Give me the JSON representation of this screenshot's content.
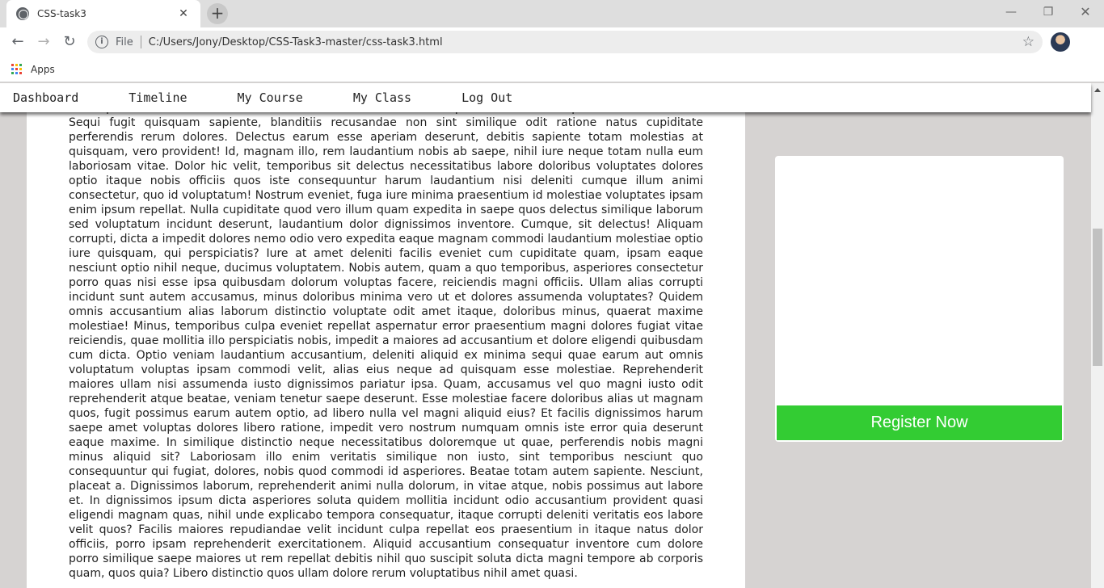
{
  "browser": {
    "tab_title": "CSS-task3",
    "tab_close": "✕",
    "new_tab": "+",
    "window_controls": {
      "minimize": "—",
      "maximize": "❐",
      "close": "✕"
    },
    "scheme_label": "File",
    "url": "C:/Users/Jony/Desktop/CSS-Task3-master/css-task3.html",
    "bookmarks": {
      "apps_label": "Apps",
      "apps_colors": [
        "#ea4335",
        "#fbbc05",
        "#34a853",
        "#4285f4",
        "#ea4335",
        "#fbbc05",
        "#34a853",
        "#4285f4",
        "#ea4335"
      ]
    }
  },
  "nav": {
    "items": [
      "Dashboard",
      "Timeline",
      "My Course",
      "My Class",
      "Log Out"
    ]
  },
  "article": {
    "body": "consequuntur cos omnis alias rerum veritatis molestias vero voluptas earum soluta quam dolores laborum. Sequi fugit quisquam sapiente, blanditiis recusandae non sint similique odit ratione natus cupiditate perferendis rerum dolores. Delectus earum esse aperiam deserunt, debitis sapiente totam molestias at quisquam, vero provident! Id, magnam illo, rem laudantium nobis ab saepe, nihil iure neque totam nulla eum laboriosam vitae. Dolor hic velit, temporibus sit delectus necessitatibus labore doloribus voluptates dolores optio itaque nobis officiis quos iste consequuntur harum laudantium nisi deleniti cumque illum animi consectetur, quo id voluptatum! Nostrum eveniet, fuga iure minima praesentium id molestiae voluptates ipsam enim ipsum repellat. Nulla cupiditate quod vero illum quam expedita in saepe quos delectus similique laborum sed voluptatum incidunt deserunt, laudantium dolor dignissimos inventore. Cumque, sit delectus! Aliquam corrupti, dicta a impedit dolores nemo odio vero expedita eaque magnam commodi laudantium molestiae optio iure quisquam, qui perspiciatis? Iure at amet deleniti facilis eveniet cum cupiditate quam, ipsam eaque nesciunt optio nihil neque, ducimus voluptatem. Nobis autem, quam a quo temporibus, asperiores consectetur porro quas nisi esse ipsa quibusdam dolorum voluptas facere, reiciendis magni officiis. Ullam alias corrupti incidunt sunt autem accusamus, minus doloribus minima vero ut et dolores assumenda voluptates? Quidem omnis accusantium alias laborum distinctio voluptate odit amet itaque, doloribus minus, quaerat maxime molestiae! Minus, temporibus culpa eveniet repellat aspernatur error praesentium magni dolores fugiat vitae reiciendis, quae mollitia illo perspiciatis nobis, impedit a maiores ad accusantium et dolore eligendi quibusdam cum dicta. Optio veniam laudantium accusantium, deleniti aliquid ex minima sequi quae earum aut omnis voluptatum voluptas ipsam commodi velit, alias eius neque ad quisquam esse molestiae. Reprehenderit maiores ullam nisi assumenda iusto dignissimos pariatur ipsa. Quam, accusamus vel quo magni iusto odit reprehenderit atque beatae, veniam tenetur saepe deserunt. Esse molestiae facere doloribus alias ut magnam quos, fugit possimus earum autem optio, ad libero nulla vel magni aliquid eius? Et facilis dignissimos harum saepe amet voluptas dolores libero ratione, impedit vero nostrum numquam omnis iste error quia deserunt eaque maxime. In similique distinctio neque necessitatibus doloremque ut quae, perferendis nobis magni minus aliquid sit? Laboriosam illo enim veritatis similique non iusto, sint temporibus nesciunt quo consequuntur qui fugiat, dolores, nobis quod commodi id asperiores. Beatae totam autem sapiente. Nesciunt, placeat a. Dignissimos laborum, reprehenderit animi nulla dolorum, in vitae atque, nobis possimus aut labore et. In dignissimos ipsum dicta asperiores soluta quidem mollitia incidunt odio accusantium provident quasi eligendi magnam quas, nihil unde explicabo tempora consequatur, itaque corrupti deleniti veritatis eos labore velit quos? Facilis maiores repudiandae velit incidunt culpa repellat eos praesentium in itaque natus dolor officiis, porro ipsam reprehenderit exercitationem. Aliquid accusantium consequatur inventore cum dolore porro similique saepe maiores ut rem repellat debitis nihil quo suscipit soluta dicta magni tempore ab corporis quam, quos quia? Libero distinctio quos ullam dolore rerum voluptatibus nihil amet quasi."
  },
  "sidebar": {
    "register_label": "Register Now",
    "register_color": "#33cc33"
  },
  "icons": {
    "back": "arrow-left-icon",
    "forward": "arrow-right-icon",
    "reload": "reload-icon",
    "info": "info-icon",
    "star": "star-icon",
    "menu": "kebab-menu-icon"
  }
}
